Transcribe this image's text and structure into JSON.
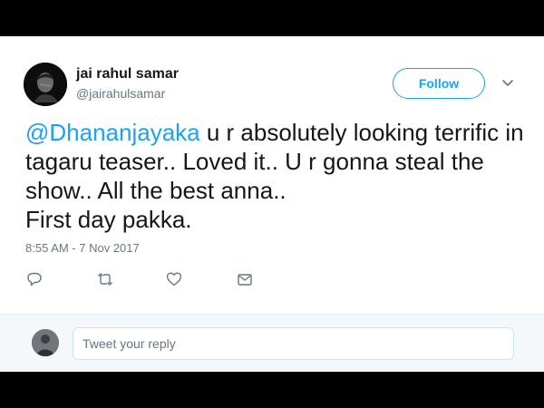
{
  "user": {
    "display_name": "jai rahul samar",
    "handle": "@jairahulsamar"
  },
  "follow_label": "Follow",
  "tweet": {
    "mention": "@Dhananjayaka",
    "body": "  u r absolutely looking terrific in tagaru teaser.. Loved it.. U r gonna steal the show.. All the best anna..",
    "last_line": "First day pakka.",
    "timestamp": "8:55 AM - 7 Nov 2017"
  },
  "actions": {
    "icons": [
      "reply-icon",
      "retweet-icon",
      "like-icon",
      "message-icon"
    ]
  },
  "reply": {
    "placeholder": "Tweet your reply"
  },
  "colors": {
    "accent": "#1da1f2",
    "text": "#14171a",
    "muted": "#657786",
    "reply_bg": "#f5f8fa"
  }
}
